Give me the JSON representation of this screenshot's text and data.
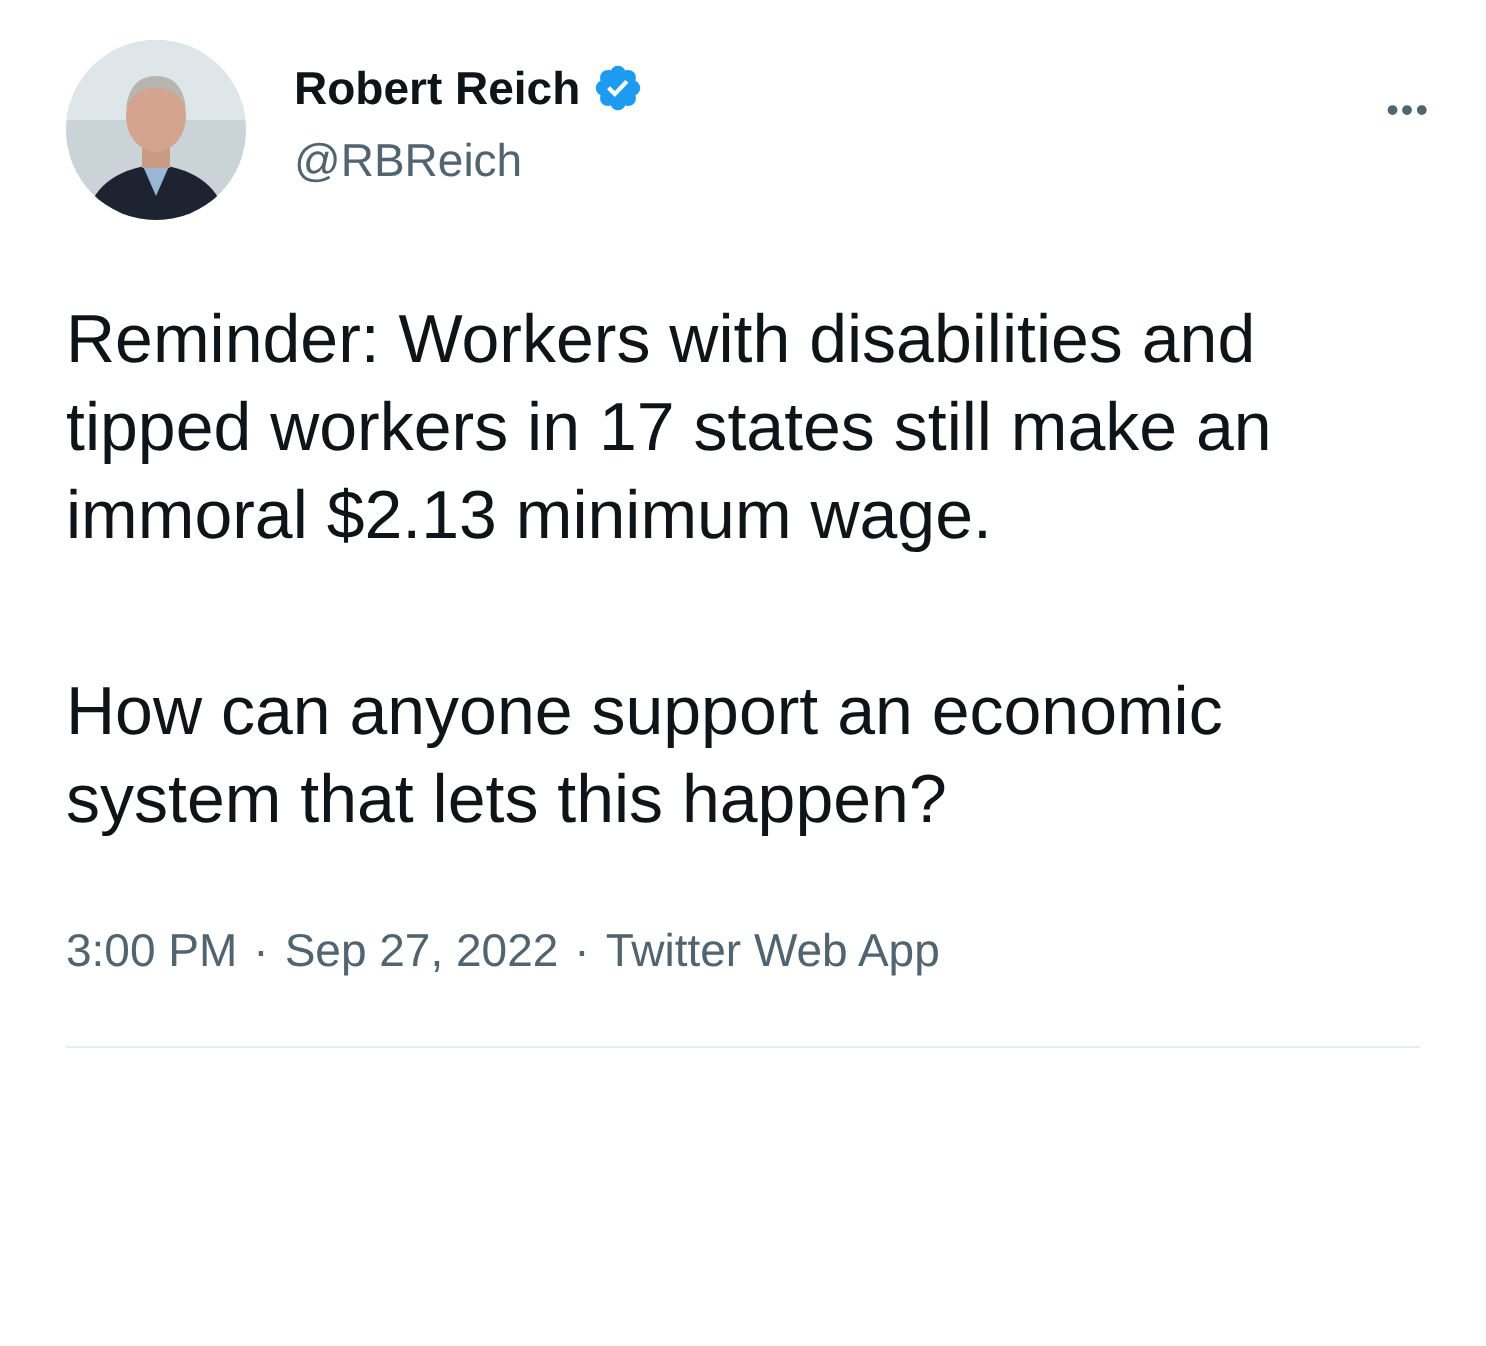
{
  "author": {
    "name": "Robert Reich",
    "verified": true,
    "handle": "@RBReich"
  },
  "menu": "•••",
  "paragraphs": [
    "Reminder: Workers with disabilities and tipped workers in 17 states still make an immoral $2.13 minimum wage.",
    "How can anyone support an economic system that lets this happen?"
  ],
  "meta": [
    {
      "text": "3:00 PM"
    },
    {
      "text": "Sep 27, 2022"
    },
    {
      "text": "Twitter Web App"
    }
  ],
  "separator": "·"
}
